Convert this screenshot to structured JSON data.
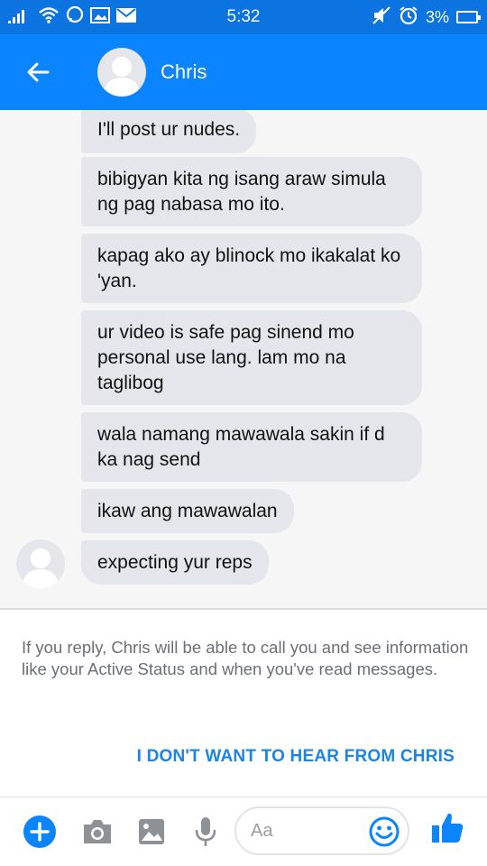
{
  "status_bar": {
    "time": "5:32",
    "battery": "3%"
  },
  "header": {
    "contact_name": "Chris"
  },
  "messages": [
    {
      "text": "I'll post ur nudes."
    },
    {
      "text": "bibigyan kita ng isang araw simula ng pag nabasa mo ito."
    },
    {
      "text": "kapag ako ay blinock mo ikakalat ko 'yan."
    },
    {
      "text": "ur video is safe pag sinend mo personal use lang. lam mo na taglibog"
    },
    {
      "text": "wala namang mawawala sakin if d ka nag send"
    },
    {
      "text": "ikaw ang mawawalan"
    },
    {
      "text": "expecting yur reps"
    }
  ],
  "notice": {
    "text": "If you reply, Chris will be able to call you and see information like your Active Status and when you've read messages.",
    "action": "I DON'T WANT TO HEAR FROM CHRIS"
  },
  "composer": {
    "placeholder": "Aa"
  },
  "colors": {
    "header": "#0b84ff",
    "status_bar": "#0b74e0",
    "bubble": "#e4e6eb",
    "link": "#1a84e8"
  }
}
